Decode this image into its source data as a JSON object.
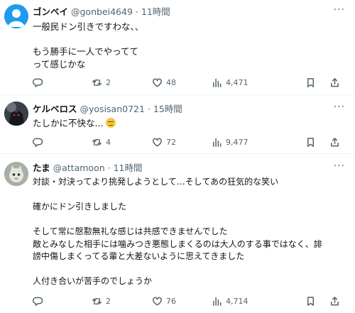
{
  "tweets": [
    {
      "name": "ゴンベイ",
      "handle": "@gonbei4649",
      "dot": "·",
      "time": "11時間",
      "more": "···",
      "lines": [
        "一般民ドン引きですわな、、",
        "",
        "もう勝手に一人でやってて",
        "って感じかな"
      ],
      "retweets": "2",
      "likes": "48",
      "views": "4,471"
    },
    {
      "name": "ケルベロス",
      "handle": "@yosisan0721",
      "dot": "·",
      "time": "15時間",
      "more": "···",
      "lines": [
        "たしかに不快な..."
      ],
      "retweets": "4",
      "likes": "72",
      "views": "9,477"
    },
    {
      "name": "たま",
      "handle": "@attamoon",
      "dot": "·",
      "time": "11時間",
      "more": "···",
      "lines": [
        "対談・対決ってより挑発しようとして…そしてあの狂気的な笑い",
        "",
        "確かにドン引きしました",
        "",
        "そして常に慇懃無礼な感じは共感できませんでした",
        "敵とみなした相手には噛みつき悪態しまくるのは大人のする事ではなく、誹",
        "謗中傷しまくってる輩と大差ないように思えてきました",
        "",
        "人付き合いが苦手のでしょうか"
      ],
      "retweets": "2",
      "likes": "76",
      "views": "4,714"
    }
  ],
  "icons": {
    "reply": "reply-icon",
    "retweet": "retweet-icon",
    "like": "like-icon",
    "views": "views-icon",
    "bookmark": "bookmark-icon",
    "share": "share-icon",
    "emoji": "expressionless-face-emoji"
  },
  "colors": {
    "text": "#0f1419",
    "secondary": "#536471",
    "divider": "#eff3f4",
    "avatar1": "#1d9bf0"
  }
}
